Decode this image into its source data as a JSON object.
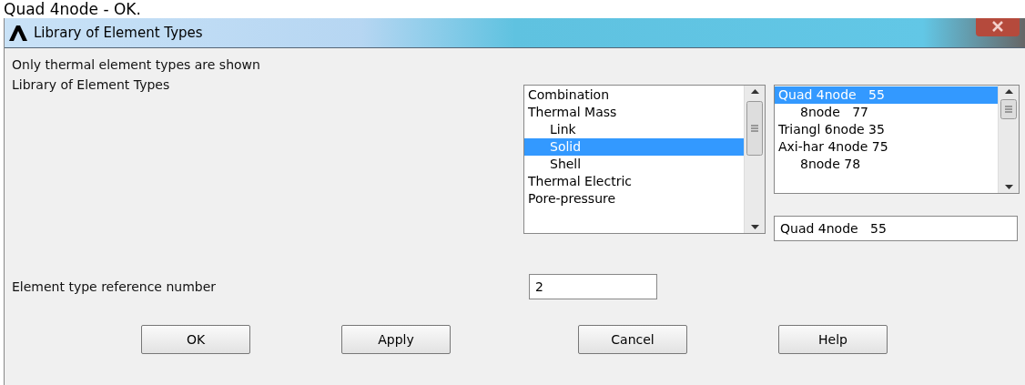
{
  "caption": "Quad 4node - OK.",
  "window": {
    "title": "Library of Element Types"
  },
  "note": "Only thermal element types are shown",
  "library_label": "Library of Element Types",
  "category_list": {
    "items": [
      {
        "label": "Combination",
        "selected": false
      },
      {
        "label": "Thermal Mass",
        "selected": false,
        "children": [
          {
            "label": "Link",
            "selected": false
          },
          {
            "label": "Solid",
            "selected": true
          },
          {
            "label": "Shell",
            "selected": false
          }
        ]
      },
      {
        "label": "Thermal Electric",
        "selected": false
      },
      {
        "label": "Pore-pressure",
        "selected": false
      }
    ]
  },
  "element_list": {
    "items": [
      {
        "label": "Quad 4node   55",
        "selected": true,
        "children": [
          {
            "label": "8node   77",
            "selected": false
          }
        ]
      },
      {
        "label": "Triangl 6node 35",
        "selected": false
      },
      {
        "label": "Axi-har 4node 75",
        "selected": false,
        "children": [
          {
            "label": "8node 78",
            "selected": false
          }
        ]
      }
    ]
  },
  "selection_field": {
    "value": "Quad 4node   55"
  },
  "reference_label": "Element type reference number",
  "reference_field": {
    "value": "2"
  },
  "buttons": [
    "OK",
    "Apply",
    "Cancel",
    "Help"
  ]
}
